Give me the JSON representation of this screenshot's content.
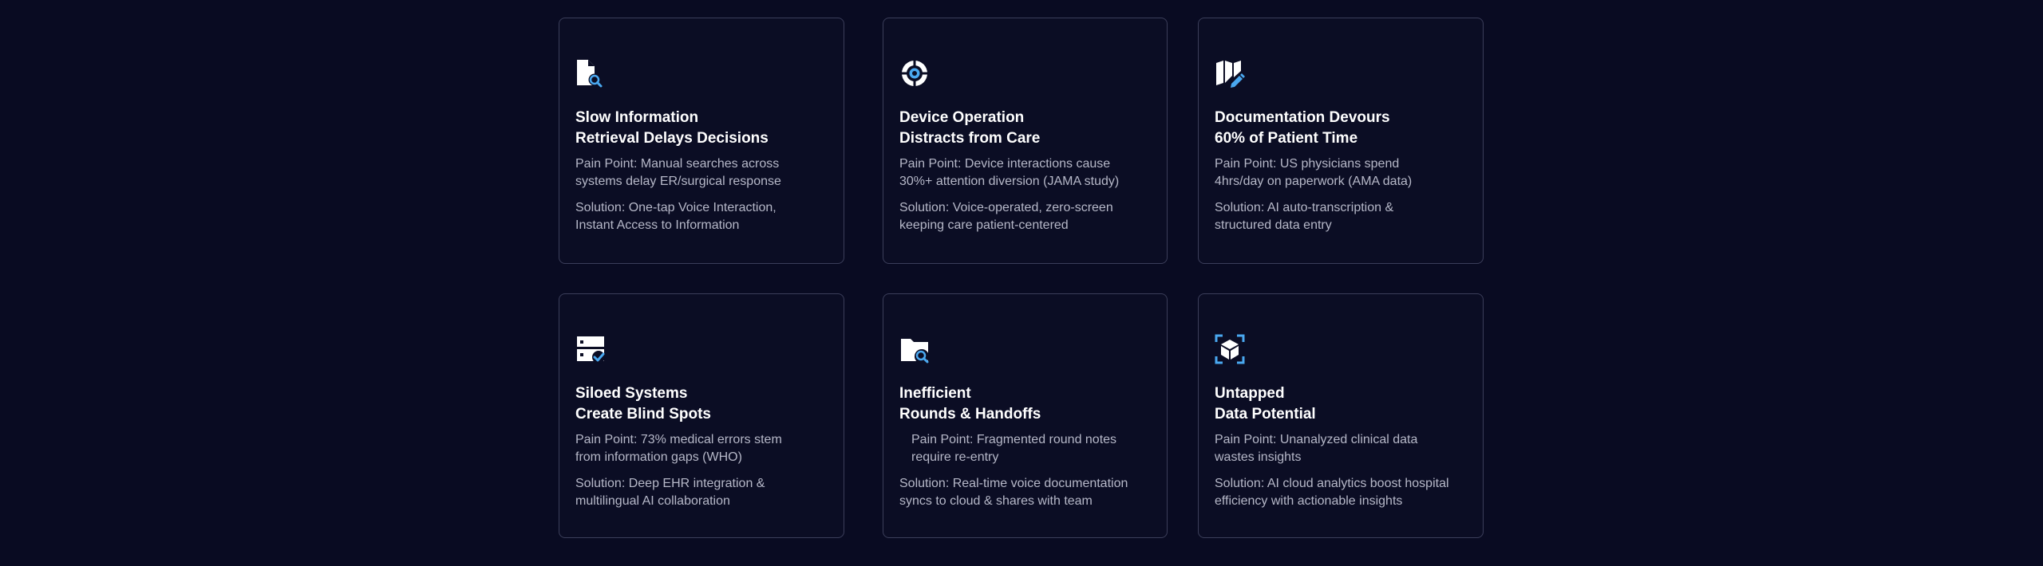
{
  "colors": {
    "background": "#090b22",
    "card_border": "#3b3e5a",
    "title": "#ffffff",
    "body_text": "#b6b8c8",
    "icon_white": "#ffffff",
    "icon_accent": "#4aa8f0"
  },
  "cards": [
    {
      "icon": "document-search-icon",
      "title_line1": "Slow Information",
      "title_line2": "Retrieval Delays Decisions",
      "pain_line1": "Pain Point: Manual searches across",
      "pain_line2": "systems delay ER/surgical response",
      "solution_line1": "Solution: One-tap Voice Interaction,",
      "solution_line2": "Instant Access to Information"
    },
    {
      "icon": "target-icon",
      "title_line1": "Device Operation",
      "title_line2": "Distracts from Care",
      "pain_line1": "Pain Point: Device interactions cause",
      "pain_line2": "30%+ attention diversion (JAMA study)",
      "solution_line1": "Solution: Voice-operated, zero-screen",
      "solution_line2": "keeping care patient-centered"
    },
    {
      "icon": "map-edit-icon",
      "title_line1": "Documentation Devours",
      "title_line2": "60% of Patient Time",
      "pain_line1": "Pain Point: US physicians spend",
      "pain_line2": "4hrs/day on paperwork (AMA data)",
      "solution_line1": "Solution: AI auto-transcription &",
      "solution_line2": "structured data entry"
    },
    {
      "icon": "server-check-icon",
      "title_line1": "Siloed Systems",
      "title_line2": "Create Blind Spots",
      "pain_line1": "Pain Point: 73% medical errors stem",
      "pain_line2": "from information gaps (WHO)",
      "solution_line1": "Solution: Deep EHR integration &",
      "solution_line2": "multilingual AI collaboration"
    },
    {
      "icon": "folder-search-icon",
      "title_line1": "Inefficient",
      "title_line2": "Rounds & Handoffs",
      "pain_line1": "Pain Point: Fragmented round notes",
      "pain_line2": "require re-entry",
      "solution_line1": "Solution: Real-time voice documentation",
      "solution_line2": "syncs to cloud & shares with team"
    },
    {
      "icon": "cube-scan-icon",
      "title_line1": "Untapped",
      "title_line2": "Data Potential",
      "pain_line1": "Pain Point: Unanalyzed clinical data",
      "pain_line2": "wastes insights",
      "solution_line1": "Solution: AI cloud analytics boost hospital",
      "solution_line2": "efficiency with actionable insights"
    }
  ]
}
